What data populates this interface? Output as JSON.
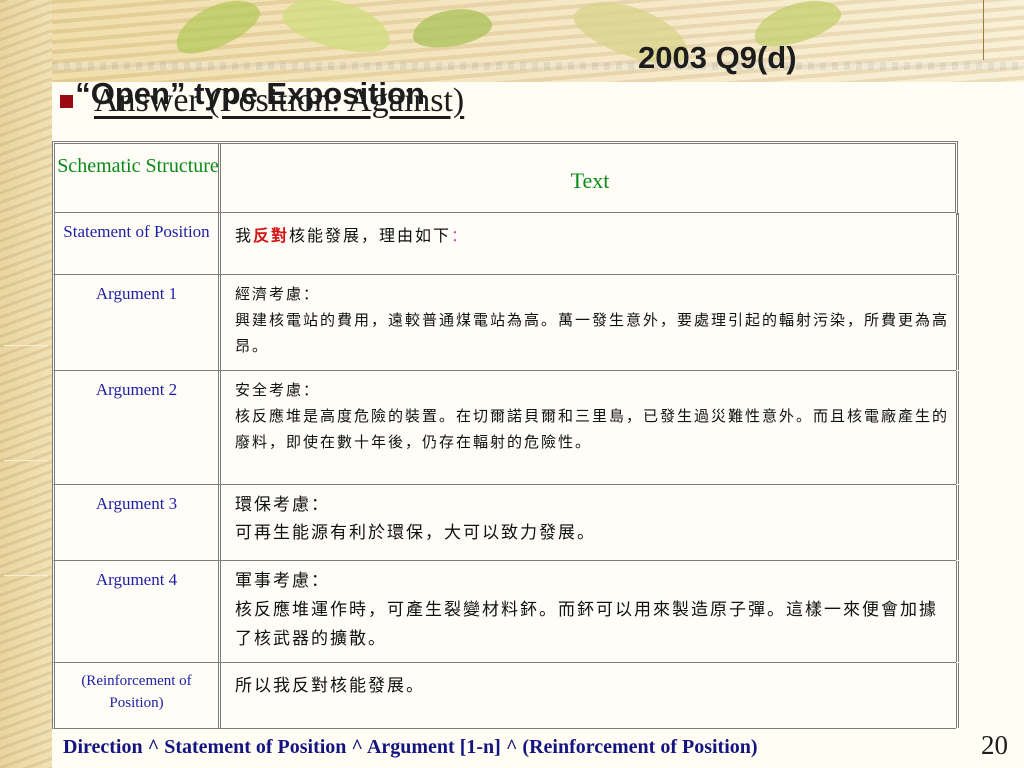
{
  "slide": {
    "title": "“Open” type Exposition",
    "title_code": "2003 Q9(d)",
    "bullet": "Answer (Position: Against)",
    "page_number": "20",
    "footer": "Direction ^ Statement of Position ^ Argument [1-n] ^ (Reinforcement of Position)"
  },
  "table": {
    "header_schematic": "Schematic Structure",
    "header_text": "Text",
    "rows": [
      {
        "label": "Statement of Position",
        "text_pre": "我",
        "text_red": "反對",
        "text_post": "核能發展，理由如下",
        "text_colon": "："
      },
      {
        "label": "Argument 1",
        "heading": "經濟考慮：",
        "body": "興建核電站的費用，遠較普通煤電站為高。萬一發生意外，要處理引起的輻射污染，所費更為高昂。"
      },
      {
        "label": "Argument 2",
        "heading": "安全考慮：",
        "body": "核反應堆是高度危險的裝置。在切爾諾貝爾和三里島，已發生過災難性意外。而且核電廠產生的廢料，即使在數十年後，仍存在輻射的危險性。"
      },
      {
        "label": "Argument 3",
        "heading": "環保考慮：",
        "body": "可再生能源有利於環保，大可以致力發展。"
      },
      {
        "label": "Argument 4",
        "heading": "軍事考慮：",
        "body": "核反應堆運作時，可產生裂變材料鈈。而鈈可以用來製造原子彈。這樣一來便會加據了核武器的擴散。"
      },
      {
        "label": "(Reinforcement of Position)",
        "body": "所以我反對核能發展。"
      }
    ]
  },
  "colors": {
    "header_green": "#0a8a1c",
    "label_blue": "#1f1fa5",
    "footer_navy": "#141480",
    "bullet_red": "#9b0a12",
    "emphasis_red": "#d41212"
  }
}
